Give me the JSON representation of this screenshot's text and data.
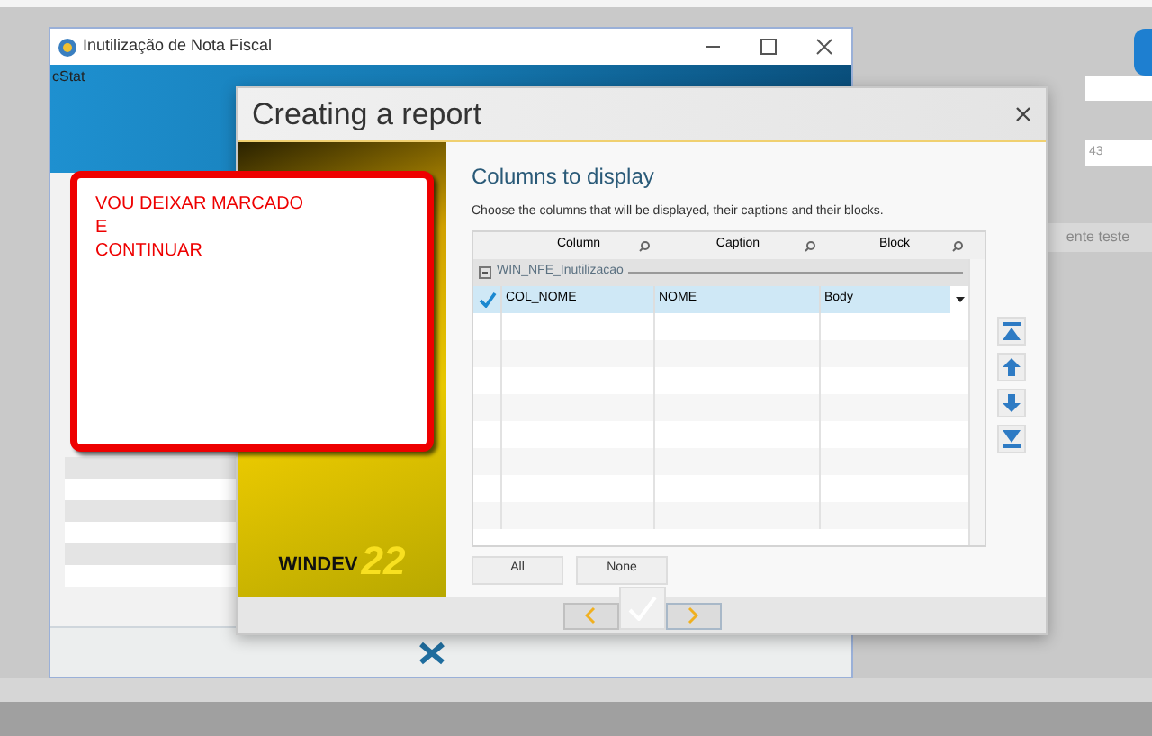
{
  "background_window": {
    "title": "Inutilização de Nota Fiscal",
    "field_label": "cStat"
  },
  "background_right": {
    "field_value": "43",
    "button": "ente teste"
  },
  "dialog": {
    "title": "Creating a report",
    "heading": "Columns to display",
    "instruction": "Choose the columns that will be displayed, their captions and their blocks.",
    "columns": [
      "Column",
      "Caption",
      "Block"
    ],
    "group": {
      "label": "WIN_NFE_Inutilizacao",
      "expanded": true
    },
    "rows": [
      {
        "checked": true,
        "selected": true,
        "column": "COL_NOME",
        "caption": "NOME",
        "block": "Body"
      }
    ],
    "buttons": [
      "All",
      "None"
    ],
    "logo": {
      "word": "WINDEV",
      "number": "22"
    }
  },
  "annotation": {
    "lines": [
      "VOU DEIXAR MARCADO",
      "E",
      "CONTINUAR"
    ]
  }
}
